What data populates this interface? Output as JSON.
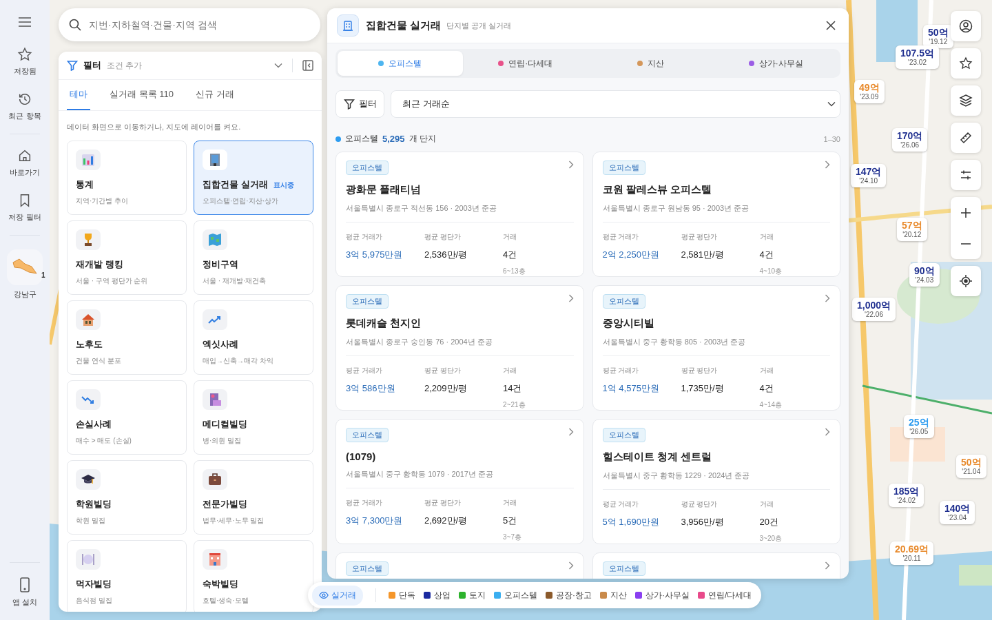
{
  "rail": {
    "items": [
      {
        "label": "저장됨"
      },
      {
        "label": "최근 항목"
      },
      {
        "label": "바로가기"
      },
      {
        "label": "저장 필터"
      },
      {
        "label": "강남구",
        "badge": "1"
      }
    ],
    "bottom": {
      "label": "앱 설치"
    }
  },
  "search": {
    "placeholder": "지번·지하철역·건물·지역 검색"
  },
  "theme_panel": {
    "filter": {
      "label": "필터",
      "hint": "조건 추가"
    },
    "tabs": [
      {
        "label": "테마",
        "selected": true
      },
      {
        "label": "실거래 목록",
        "count": "110",
        "selected": false
      },
      {
        "label": "신규 거래",
        "selected": false
      }
    ],
    "hint": "데이터 화면으로 이동하거나, 지도에 레이어를 켜요.",
    "cards": [
      {
        "title": "통계",
        "subtitle": "지역·기간별 추이",
        "selected": false
      },
      {
        "title": "집합건물 실거래",
        "badge": "표시중",
        "subtitle": "오피스텔·연립·지산·상가",
        "selected": true
      },
      {
        "title": "재개발 랭킹",
        "subtitle": "서울 · 구역 평단가 순위",
        "selected": false
      },
      {
        "title": "정비구역",
        "subtitle": "서울 · 재개발·재건축",
        "selected": false
      },
      {
        "title": "노후도",
        "subtitle": "건물 연식 분포",
        "selected": false
      },
      {
        "title": "엑싯사례",
        "subtitle": "매입→신축→매각 차익",
        "selected": false
      },
      {
        "title": "손실사례",
        "subtitle": "매수 > 매도 (손실)",
        "selected": false
      },
      {
        "title": "메디컬빌딩",
        "subtitle": "병·의원 밀집",
        "selected": false
      },
      {
        "title": "학원빌딩",
        "subtitle": "학원 밀집",
        "selected": false
      },
      {
        "title": "전문가빌딩",
        "subtitle": "법무·세무·노무 밀집",
        "selected": false
      },
      {
        "title": "먹자빌딩",
        "subtitle": "음식점 밀집",
        "selected": false
      },
      {
        "title": "숙박빌딩",
        "subtitle": "호텔·생숙·모텔",
        "selected": false
      }
    ]
  },
  "detail_panel": {
    "title": "집합건물 실거래",
    "subtitle": "단지별 공개 실거래",
    "tabs": [
      {
        "label": "오피스텔",
        "color": "#4db5f0",
        "selected": true
      },
      {
        "label": "연립·다세대",
        "color": "#e8528a",
        "selected": false
      },
      {
        "label": "지산",
        "color": "#d4975a",
        "selected": false
      },
      {
        "label": "상가·사무실",
        "color": "#9b5de5",
        "selected": false
      }
    ],
    "filter_button": "필터",
    "sort": "최근 거래순",
    "summary": {
      "color": "#2d9cf0",
      "category": "오피스텔",
      "count": "5,295",
      "unit": "개 단지",
      "range": "1–30"
    },
    "listings": [
      {
        "type": "오피스텔",
        "name": "광화문 플래티넘",
        "address": "서울특별시 종로구 적선동 156 · 2003년 준공",
        "stats": [
          {
            "label": "평균 거래가",
            "value": "3억 5,975만원"
          },
          {
            "label": "평균 평단가",
            "value": "2,536만/평"
          },
          {
            "label": "거래",
            "value": "4건",
            "note": "6~13층"
          }
        ]
      },
      {
        "type": "오피스텔",
        "name": "코원 팔레스뷰 오피스텔",
        "address": "서울특별시 종로구 원남동 95 · 2003년 준공",
        "stats": [
          {
            "label": "평균 거래가",
            "value": "2억 2,250만원"
          },
          {
            "label": "평균 평단가",
            "value": "2,581만/평"
          },
          {
            "label": "거래",
            "value": "4건",
            "note": "4~10층"
          }
        ]
      },
      {
        "type": "오피스텔",
        "name": "롯데캐슬 천지인",
        "address": "서울특별시 종로구 숭인동 76 · 2004년 준공",
        "stats": [
          {
            "label": "평균 거래가",
            "value": "3억 586만원"
          },
          {
            "label": "평균 평단가",
            "value": "2,209만/평"
          },
          {
            "label": "거래",
            "value": "14건",
            "note": "2~21층"
          }
        ]
      },
      {
        "type": "오피스텔",
        "name": "중앙시티빌",
        "address": "서울특별시 중구 황학동 805 · 2003년 준공",
        "stats": [
          {
            "label": "평균 거래가",
            "value": "1억 4,575만원"
          },
          {
            "label": "평균 평단가",
            "value": "1,735만/평"
          },
          {
            "label": "거래",
            "value": "4건",
            "note": "4~14층"
          }
        ]
      },
      {
        "type": "오피스텔",
        "name": "(1079)",
        "address": "서울특별시 중구 황학동 1079 · 2017년 준공",
        "stats": [
          {
            "label": "평균 거래가",
            "value": "3억 7,300만원"
          },
          {
            "label": "평균 평단가",
            "value": "2,692만/평"
          },
          {
            "label": "거래",
            "value": "5건",
            "note": "3~7층"
          }
        ]
      },
      {
        "type": "오피스텔",
        "name": "힐스테이트 청계 센트럴",
        "address": "서울특별시 중구 황학동 1229 · 2024년 준공",
        "stats": [
          {
            "label": "평균 거래가",
            "value": "5억 1,690만원"
          },
          {
            "label": "평균 평단가",
            "value": "3,956만/평"
          },
          {
            "label": "거래",
            "value": "20건",
            "note": "3~20층"
          }
        ]
      },
      {
        "type": "오피스텔"
      },
      {
        "type": "오피스텔"
      }
    ]
  },
  "legend": {
    "toggle": {
      "label": "실거래",
      "selected": true
    },
    "items": [
      {
        "label": "단독",
        "color": "#f5962a"
      },
      {
        "label": "상업",
        "color": "#1a2aa0"
      },
      {
        "label": "토지",
        "color": "#2db32d"
      },
      {
        "label": "오피스텔",
        "color": "#3aaef0"
      },
      {
        "label": "공장·창고",
        "color": "#8b5a2b"
      },
      {
        "label": "지산",
        "color": "#c98a4a"
      },
      {
        "label": "상가·사무실",
        "color": "#8a3ff0"
      },
      {
        "label": "연립/다세대",
        "color": "#e84a8a"
      }
    ]
  },
  "map_markers": [
    {
      "price": "50억",
      "date": "'19.12",
      "color": "#1f2f8f"
    },
    {
      "price": "107.5억",
      "date": "'23.02",
      "color": "#1f2f8f"
    },
    {
      "price": "49억",
      "date": "'23.09",
      "color": "#e8892a"
    },
    {
      "price": "170억",
      "date": "'26.06",
      "color": "#1f2f8f"
    },
    {
      "price": "147억",
      "date": "'24.10",
      "color": "#1f2f8f"
    },
    {
      "price": "57억",
      "date": "'20.12",
      "color": "#e8892a"
    },
    {
      "price": "90억",
      "date": "'24.03",
      "color": "#1f2f8f"
    },
    {
      "price": "1,000억",
      "date": "'22.06",
      "color": "#1f2f8f"
    },
    {
      "price": "25억",
      "date": "'26.05",
      "color": "#2d9cf0"
    },
    {
      "price": "50억",
      "date": "'21.04",
      "color": "#e8892a"
    },
    {
      "price": "185억",
      "date": "'24.02",
      "color": "#1f2f8f"
    },
    {
      "price": "140억",
      "date": "'23.04",
      "color": "#1f2f8f"
    },
    {
      "price": "20.69억",
      "date": "'20.11",
      "color": "#e8892a"
    }
  ]
}
